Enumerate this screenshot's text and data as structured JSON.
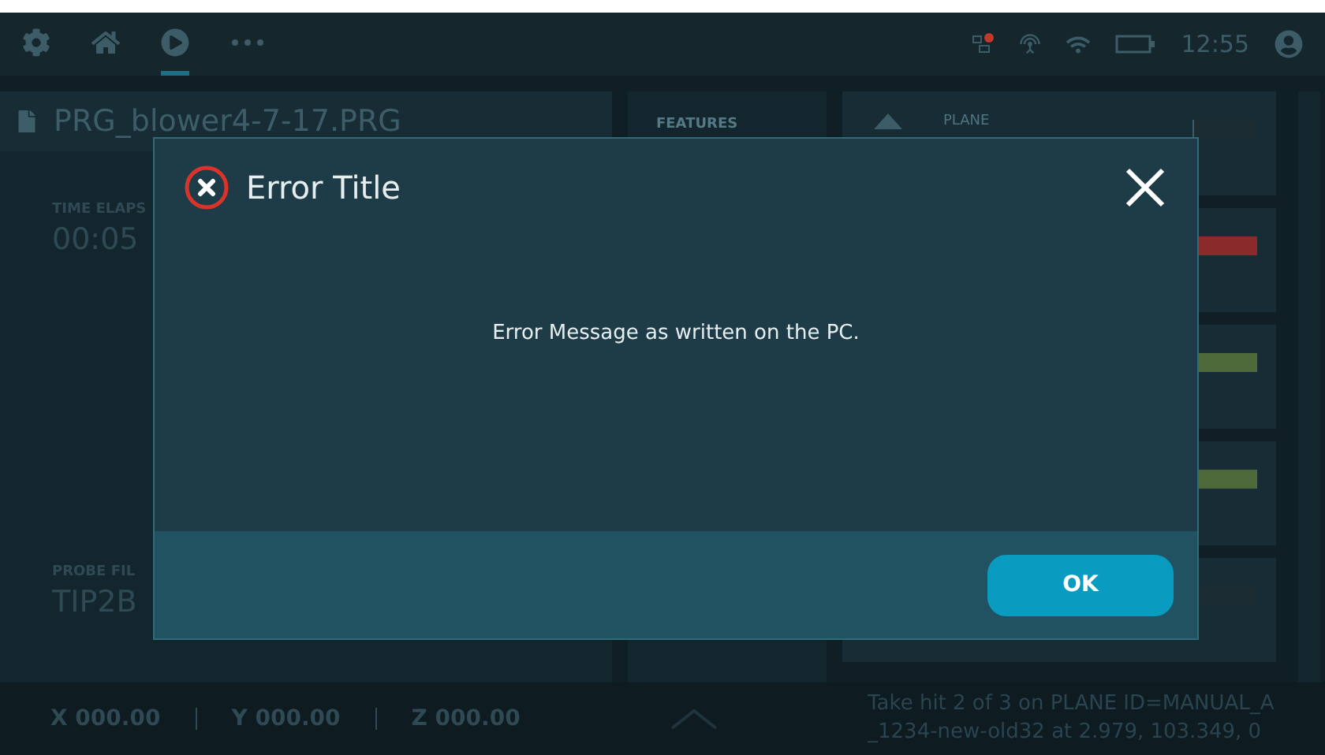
{
  "top_bar": {
    "nav": [
      {
        "kind": "settings",
        "selected": false
      },
      {
        "kind": "home",
        "selected": false
      },
      {
        "kind": "play",
        "selected": true
      },
      {
        "kind": "more",
        "selected": false
      }
    ],
    "network_alert": true,
    "time": "12:55"
  },
  "program_panel": {
    "file_name": "PRG_blower4-7-17.PRG",
    "fields": [
      {
        "label": "TIME ELAPS",
        "value": "00:05"
      },
      {
        "label": "PROBE FIL",
        "value": "TIP2B"
      }
    ]
  },
  "features_panel": {
    "title": "FEATURES"
  },
  "feature_list": [
    {
      "name": "PLANE",
      "color": "#1b2c33"
    },
    {
      "color": "#8a2a2a"
    },
    {
      "color": "#4f6a3a"
    },
    {
      "color": "#4f6a3a"
    },
    {
      "color": "#1b2c33"
    }
  ],
  "status_bar": {
    "coords": [
      {
        "axis": "X",
        "value": "000.00"
      },
      {
        "axis": "Y",
        "value": "000.00"
      },
      {
        "axis": "Z",
        "value": "000.00"
      }
    ],
    "message": "Take  hit 2 of 3 on PLANE ID=MANUAL_A _1234-new-old32 at 2.979, 103.349, 0"
  },
  "dialog": {
    "title": "Error Title",
    "message": "Error Message as written on the PC.",
    "button": "OK"
  }
}
